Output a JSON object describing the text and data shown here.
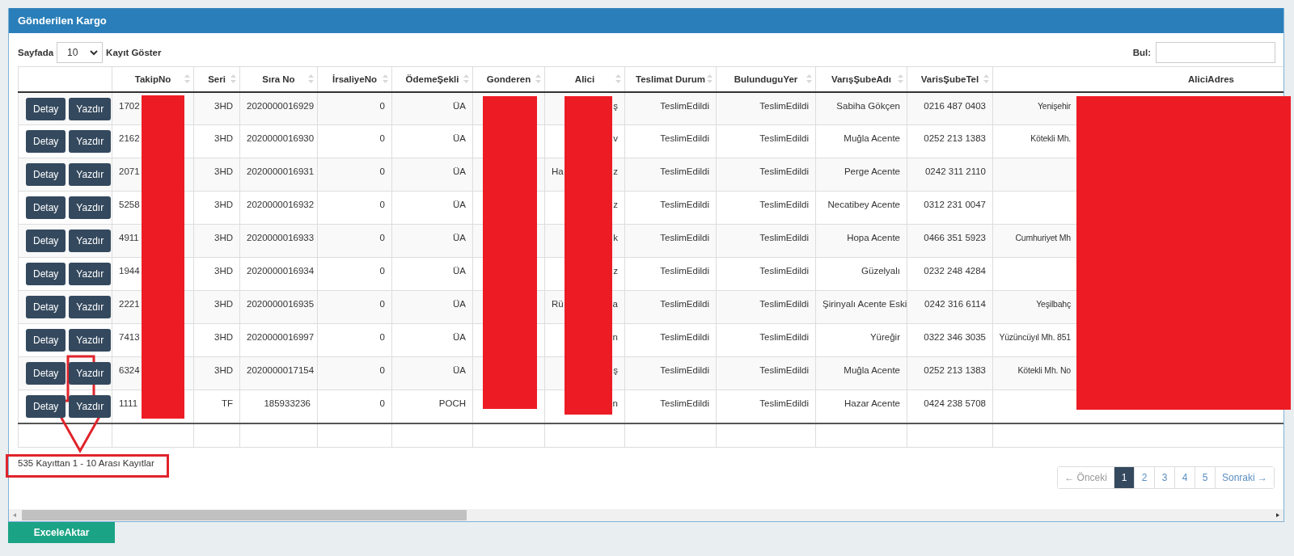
{
  "panel": {
    "title": "Gönderilen Kargo"
  },
  "length_menu": {
    "label_before": "Sayfada",
    "value": "10",
    "label_after": "Kayıt Göster"
  },
  "search": {
    "label": "Bul:"
  },
  "table": {
    "columns": [
      {
        "label": "TakipNo"
      },
      {
        "label": "Seri"
      },
      {
        "label": "Sıra No"
      },
      {
        "label": "İrsaliyeNo"
      },
      {
        "label": "ÖdemeŞekli"
      },
      {
        "label": "Gonderen"
      },
      {
        "label": "Alici"
      },
      {
        "label": "Teslimat Durum"
      },
      {
        "label": "BulunduguYer"
      },
      {
        "label": "VarışŞubeAdı"
      },
      {
        "label": "VarisŞubeTel"
      },
      {
        "label": "AliciAdres"
      }
    ],
    "rows": [
      {
        "actions": [
          "Detay",
          "Yazdır"
        ],
        "takip_no": "1702",
        "seri": "3HD",
        "sira_no": "2020000016929",
        "irsaliye_no": "0",
        "odeme_sekli": "ÜA",
        "alici": {
          "end": "ş"
        },
        "teslimat_durum": "TeslimEdildi",
        "bulundugu_yer": "TeslimEdildi",
        "varis_sube_adi": "Sabiha Gökçen",
        "varis_sube_tel": "0216 487 0403",
        "alici_adres": "Yenişehir"
      },
      {
        "actions": [
          "Detay",
          "Yazdır"
        ],
        "takip_no": "2162",
        "seri": "3HD",
        "sira_no": "2020000016930",
        "irsaliye_no": "0",
        "odeme_sekli": "ÜA",
        "alici": {
          "end": "v"
        },
        "teslimat_durum": "TeslimEdildi",
        "bulundugu_yer": "TeslimEdildi",
        "varis_sube_adi": "Muğla Acente",
        "varis_sube_tel": "0252 213 1383",
        "alici_adres": "Kötekli Mh."
      },
      {
        "actions": [
          "Detay",
          "Yazdır"
        ],
        "takip_no": "2071",
        "seri": "3HD",
        "sira_no": "2020000016931",
        "irsaliye_no": "0",
        "odeme_sekli": "ÜA",
        "alici": {
          "start": "Ha",
          "end": "z"
        },
        "teslimat_durum": "TeslimEdildi",
        "bulundugu_yer": "TeslimEdildi",
        "varis_sube_adi": "Perge Acente",
        "varis_sube_tel": "0242 311 2110"
      },
      {
        "actions": [
          "Detay",
          "Yazdır"
        ],
        "takip_no": "5258",
        "seri": "3HD",
        "sira_no": "2020000016932",
        "irsaliye_no": "0",
        "odeme_sekli": "ÜA",
        "alici": {
          "end": "z"
        },
        "teslimat_durum": "TeslimEdildi",
        "bulundugu_yer": "TeslimEdildi",
        "varis_sube_adi": "Necatibey Acente",
        "varis_sube_tel": "0312 231 0047"
      },
      {
        "actions": [
          "Detay",
          "Yazdır"
        ],
        "takip_no": "4911",
        "seri": "3HD",
        "sira_no": "2020000016933",
        "irsaliye_no": "0",
        "odeme_sekli": "ÜA",
        "alici": {
          "end": "k"
        },
        "teslimat_durum": "TeslimEdildi",
        "bulundugu_yer": "TeslimEdildi",
        "varis_sube_adi": "Hopa Acente",
        "varis_sube_tel": "0466 351 5923",
        "alici_adres": "Cumhuriyet Mh"
      },
      {
        "actions": [
          "Detay",
          "Yazdır"
        ],
        "takip_no": "1944",
        "seri": "3HD",
        "sira_no": "2020000016934",
        "irsaliye_no": "0",
        "odeme_sekli": "ÜA",
        "alici": {
          "end": "z"
        },
        "teslimat_durum": "TeslimEdildi",
        "bulundugu_yer": "TeslimEdildi",
        "varis_sube_adi": "Güzelyalı",
        "varis_sube_tel": "0232 248 4284"
      },
      {
        "actions": [
          "Detay",
          "Yazdır"
        ],
        "takip_no": "2221",
        "seri": "3HD",
        "sira_no": "2020000016935",
        "irsaliye_no": "0",
        "odeme_sekli": "ÜA",
        "alici": {
          "start": "Rü",
          "end": "a"
        },
        "teslimat_durum": "TeslimEdildi",
        "bulundugu_yer": "TeslimEdildi",
        "varis_sube_adi": "Şirinyalı Acente Eski",
        "varis_sube_tel": "0242 316 6114",
        "alici_adres": "Yeşilbahç"
      },
      {
        "actions": [
          "Detay",
          "Yazdır"
        ],
        "takip_no": "7413",
        "seri": "3HD",
        "sira_no": "2020000016997",
        "irsaliye_no": "0",
        "odeme_sekli": "ÜA",
        "alici": {
          "end": "n"
        },
        "teslimat_durum": "TeslimEdildi",
        "bulundugu_yer": "TeslimEdildi",
        "varis_sube_adi": "Yüreğir",
        "varis_sube_tel": "0322 346 3035",
        "alici_adres": "Yüzüncüyıl Mh. 851"
      },
      {
        "actions": [
          "Detay",
          "Yazdır"
        ],
        "takip_no": "6324",
        "seri": "3HD",
        "sira_no": "2020000017154",
        "irsaliye_no": "0",
        "odeme_sekli": "ÜA",
        "alici": {
          "end": "ş"
        },
        "teslimat_durum": "TeslimEdildi",
        "bulundugu_yer": "TeslimEdildi",
        "varis_sube_adi": "Muğla Acente",
        "varis_sube_tel": "0252 213 1383",
        "alici_adres": "Kötekli Mh. No"
      },
      {
        "actions": [
          "Detay",
          "Yazdır"
        ],
        "takip_no": "1111",
        "seri": "TF",
        "sira_no": "185933236",
        "irsaliye_no": "0",
        "odeme_sekli": "POCH",
        "alici": {
          "end": "n"
        },
        "teslimat_durum": "TeslimEdildi",
        "bulundugu_yer": "TeslimEdildi",
        "varis_sube_adi": "Hazar Acente",
        "varis_sube_tel": "0424 238 5708"
      }
    ]
  },
  "info": "535 Kayıttan 1 - 10 Arası Kayıtlar",
  "pagination": [
    {
      "label": "← Önceki",
      "selected": false
    },
    {
      "label": "1",
      "selected": true
    },
    {
      "label": "2",
      "selected": false
    },
    {
      "label": "3",
      "selected": false
    },
    {
      "label": "4",
      "selected": false
    },
    {
      "label": "5",
      "selected": false
    },
    {
      "label": "Sonraki →",
      "selected": false
    }
  ],
  "export_button": "ExceleAktar"
}
